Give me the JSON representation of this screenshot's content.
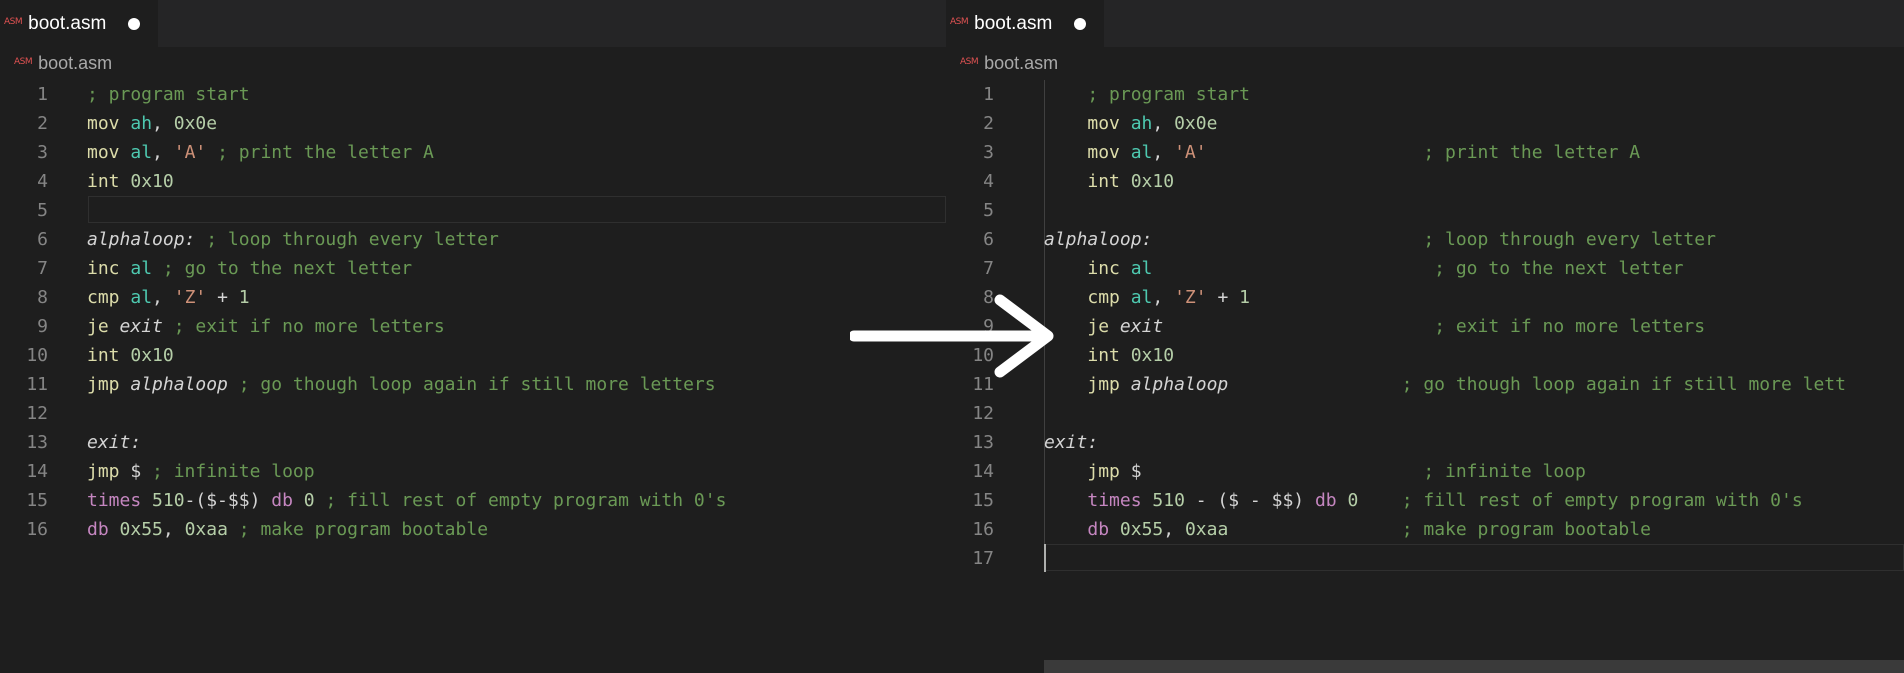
{
  "left": {
    "tab": {
      "icon": "ASM",
      "label": "boot.asm"
    },
    "breadcrumb": {
      "icon": "ASM",
      "label": "boot.asm"
    },
    "lines": [
      {
        "n": "1",
        "tokens": [
          {
            "t": "; program start",
            "c": "cmt"
          }
        ]
      },
      {
        "n": "2",
        "tokens": [
          {
            "t": "mov",
            "c": "kw"
          },
          {
            "t": " "
          },
          {
            "t": "ah",
            "c": "reg"
          },
          {
            "t": ", "
          },
          {
            "t": "0x0e",
            "c": "num"
          }
        ]
      },
      {
        "n": "3",
        "tokens": [
          {
            "t": "mov",
            "c": "kw"
          },
          {
            "t": " "
          },
          {
            "t": "al",
            "c": "reg"
          },
          {
            "t": ", "
          },
          {
            "t": "'A'",
            "c": "str"
          },
          {
            "t": " "
          },
          {
            "t": "; print the letter A",
            "c": "cmt"
          }
        ]
      },
      {
        "n": "4",
        "tokens": [
          {
            "t": "int",
            "c": "kw"
          },
          {
            "t": " "
          },
          {
            "t": "0x10",
            "c": "num"
          }
        ]
      },
      {
        "n": "5",
        "tokens": []
      },
      {
        "n": "6",
        "tokens": [
          {
            "t": "alphaloop:",
            "c": "lbl"
          },
          {
            "t": " "
          },
          {
            "t": "; loop through every letter",
            "c": "cmt"
          }
        ]
      },
      {
        "n": "7",
        "tokens": [
          {
            "t": "inc",
            "c": "kw"
          },
          {
            "t": " "
          },
          {
            "t": "al",
            "c": "reg"
          },
          {
            "t": " "
          },
          {
            "t": "; go to the next letter",
            "c": "cmt"
          }
        ]
      },
      {
        "n": "8",
        "tokens": [
          {
            "t": "cmp",
            "c": "kw"
          },
          {
            "t": " "
          },
          {
            "t": "al",
            "c": "reg"
          },
          {
            "t": ", "
          },
          {
            "t": "'Z'",
            "c": "str"
          },
          {
            "t": " + "
          },
          {
            "t": "1",
            "c": "num"
          }
        ]
      },
      {
        "n": "9",
        "tokens": [
          {
            "t": "je",
            "c": "kw"
          },
          {
            "t": " "
          },
          {
            "t": "exit",
            "c": "lbl"
          },
          {
            "t": " "
          },
          {
            "t": "; exit if no more letters",
            "c": "cmt"
          }
        ]
      },
      {
        "n": "10",
        "tokens": [
          {
            "t": "int",
            "c": "kw"
          },
          {
            "t": " "
          },
          {
            "t": "0x10",
            "c": "num"
          }
        ]
      },
      {
        "n": "11",
        "tokens": [
          {
            "t": "jmp",
            "c": "kw"
          },
          {
            "t": " "
          },
          {
            "t": "alphaloop",
            "c": "lbl"
          },
          {
            "t": " "
          },
          {
            "t": "; go though loop again if still more letters",
            "c": "cmt"
          }
        ]
      },
      {
        "n": "12",
        "tokens": []
      },
      {
        "n": "13",
        "tokens": [
          {
            "t": "exit:",
            "c": "lbl"
          }
        ]
      },
      {
        "n": "14",
        "tokens": [
          {
            "t": "jmp",
            "c": "kw"
          },
          {
            "t": " $ "
          },
          {
            "t": "; infinite loop",
            "c": "cmt"
          }
        ]
      },
      {
        "n": "15",
        "tokens": [
          {
            "t": "times",
            "c": "dir"
          },
          {
            "t": " "
          },
          {
            "t": "510",
            "c": "num"
          },
          {
            "t": "-($-$$) "
          },
          {
            "t": "db",
            "c": "dir"
          },
          {
            "t": " "
          },
          {
            "t": "0",
            "c": "num"
          },
          {
            "t": " "
          },
          {
            "t": "; fill rest of empty program with 0's",
            "c": "cmt"
          }
        ]
      },
      {
        "n": "16",
        "tokens": [
          {
            "t": "db",
            "c": "dir"
          },
          {
            "t": " "
          },
          {
            "t": "0x55",
            "c": "num"
          },
          {
            "t": ", "
          },
          {
            "t": "0xaa",
            "c": "num"
          },
          {
            "t": " "
          },
          {
            "t": "; make program bootable",
            "c": "cmt"
          }
        ]
      }
    ]
  },
  "right": {
    "tab": {
      "icon": "ASM",
      "label": "boot.asm"
    },
    "breadcrumb": {
      "icon": "ASM",
      "label": "boot.asm"
    },
    "lines": [
      {
        "n": "1",
        "tokens": [
          {
            "t": "    "
          },
          {
            "t": "; program start",
            "c": "cmt"
          }
        ]
      },
      {
        "n": "2",
        "tokens": [
          {
            "t": "    "
          },
          {
            "t": "mov",
            "c": "kw"
          },
          {
            "t": " "
          },
          {
            "t": "ah",
            "c": "reg"
          },
          {
            "t": ", "
          },
          {
            "t": "0x0e",
            "c": "num"
          }
        ]
      },
      {
        "n": "3",
        "tokens": [
          {
            "t": "    "
          },
          {
            "t": "mov",
            "c": "kw"
          },
          {
            "t": " "
          },
          {
            "t": "al",
            "c": "reg"
          },
          {
            "t": ", "
          },
          {
            "t": "'A'",
            "c": "str"
          },
          {
            "t": "                    "
          },
          {
            "t": "; print the letter A",
            "c": "cmt"
          }
        ]
      },
      {
        "n": "4",
        "tokens": [
          {
            "t": "    "
          },
          {
            "t": "int",
            "c": "kw"
          },
          {
            "t": " "
          },
          {
            "t": "0x10",
            "c": "num"
          }
        ]
      },
      {
        "n": "5",
        "tokens": []
      },
      {
        "n": "6",
        "tokens": [
          {
            "t": "alphaloop:",
            "c": "lbl"
          },
          {
            "t": "                         "
          },
          {
            "t": "; loop through every letter",
            "c": "cmt"
          }
        ]
      },
      {
        "n": "7",
        "tokens": [
          {
            "t": "    "
          },
          {
            "t": "inc",
            "c": "kw"
          },
          {
            "t": " "
          },
          {
            "t": "al",
            "c": "reg"
          },
          {
            "t": "                          "
          },
          {
            "t": "; go to the next letter",
            "c": "cmt"
          }
        ]
      },
      {
        "n": "8",
        "tokens": [
          {
            "t": "    "
          },
          {
            "t": "cmp",
            "c": "kw"
          },
          {
            "t": " "
          },
          {
            "t": "al",
            "c": "reg"
          },
          {
            "t": ", "
          },
          {
            "t": "'Z'",
            "c": "str"
          },
          {
            "t": " + "
          },
          {
            "t": "1",
            "c": "num"
          }
        ]
      },
      {
        "n": "9",
        "tokens": [
          {
            "t": "    "
          },
          {
            "t": "je",
            "c": "kw"
          },
          {
            "t": " "
          },
          {
            "t": "exit",
            "c": "lbl"
          },
          {
            "t": "                         "
          },
          {
            "t": "; exit if no more letters",
            "c": "cmt"
          }
        ]
      },
      {
        "n": "10",
        "tokens": [
          {
            "t": "    "
          },
          {
            "t": "int",
            "c": "kw"
          },
          {
            "t": " "
          },
          {
            "t": "0x10",
            "c": "num"
          }
        ]
      },
      {
        "n": "11",
        "tokens": [
          {
            "t": "    "
          },
          {
            "t": "jmp",
            "c": "kw"
          },
          {
            "t": " "
          },
          {
            "t": "alphaloop",
            "c": "lbl"
          },
          {
            "t": "                "
          },
          {
            "t": "; go though loop again if still more lett",
            "c": "cmt"
          }
        ]
      },
      {
        "n": "12",
        "tokens": []
      },
      {
        "n": "13",
        "tokens": [
          {
            "t": "exit:",
            "c": "lbl"
          }
        ]
      },
      {
        "n": "14",
        "tokens": [
          {
            "t": "    "
          },
          {
            "t": "jmp",
            "c": "kw"
          },
          {
            "t": " $                          "
          },
          {
            "t": "; infinite loop",
            "c": "cmt"
          }
        ]
      },
      {
        "n": "15",
        "tokens": [
          {
            "t": "    "
          },
          {
            "t": "times",
            "c": "dir"
          },
          {
            "t": " "
          },
          {
            "t": "510",
            "c": "num"
          },
          {
            "t": " - ($ - $$) "
          },
          {
            "t": "db",
            "c": "dir"
          },
          {
            "t": " "
          },
          {
            "t": "0",
            "c": "num"
          },
          {
            "t": "    "
          },
          {
            "t": "; fill rest of empty program with 0's",
            "c": "cmt"
          }
        ]
      },
      {
        "n": "16",
        "tokens": [
          {
            "t": "    "
          },
          {
            "t": "db",
            "c": "dir"
          },
          {
            "t": " "
          },
          {
            "t": "0x55",
            "c": "num"
          },
          {
            "t": ", "
          },
          {
            "t": "0xaa",
            "c": "num"
          },
          {
            "t": "                "
          },
          {
            "t": "; make program bootable",
            "c": "cmt"
          }
        ]
      },
      {
        "n": "17",
        "tokens": []
      }
    ]
  },
  "colors": {
    "kw": "#dcdcaa",
    "reg": "#4ec9b0",
    "num": "#b5cea8",
    "str": "#ce9178",
    "cmt": "#6a9955",
    "dir": "#c586c0",
    "arrow": "#ffffff"
  },
  "icons": {
    "arrow": "right-arrow-icon",
    "dirty": "unsaved-dot-icon"
  }
}
